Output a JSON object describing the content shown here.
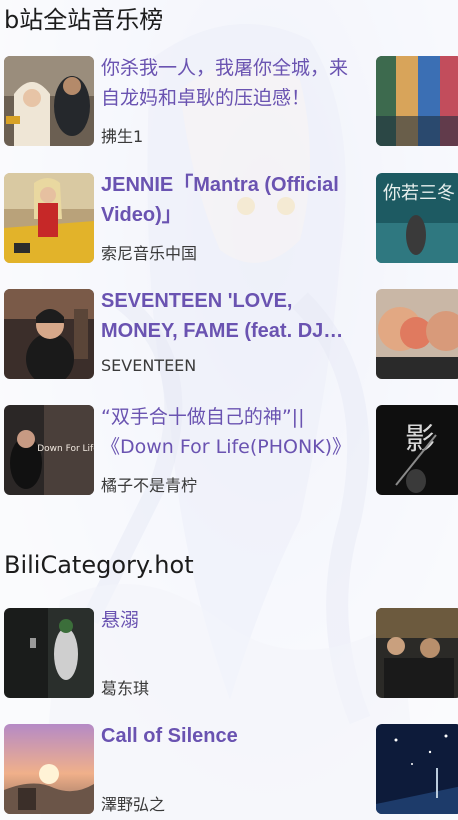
{
  "sections": [
    {
      "title": "b站全站音乐榜",
      "items": [
        {
          "title": "你杀我一人，我屠你全城，来自龙妈和卓耿的压迫感！",
          "artist": "拂生1"
        },
        {
          "title": "JENNIE「Mantra (Official Video)」",
          "artist": "索尼音乐中国"
        },
        {
          "title": "SEVENTEEN 'LOVE, MONEY, FAME (feat. DJ Khaled)' Official MV",
          "artist": "SEVENTEEN"
        },
        {
          "title": "“双手合十做自己的神”||《Down For Life(PHONK)》",
          "artist": "橘子不是青柠"
        }
      ]
    },
    {
      "title": "BiliCategory.hot",
      "items": [
        {
          "title": "悬溺",
          "artist": "葛东琪"
        },
        {
          "title": "Call of Silence",
          "artist": "澤野弘之"
        }
      ]
    }
  ],
  "thumb_texts": {
    "item4": "Down For Life",
    "right1": "你若三冬",
    "right4": "影"
  }
}
